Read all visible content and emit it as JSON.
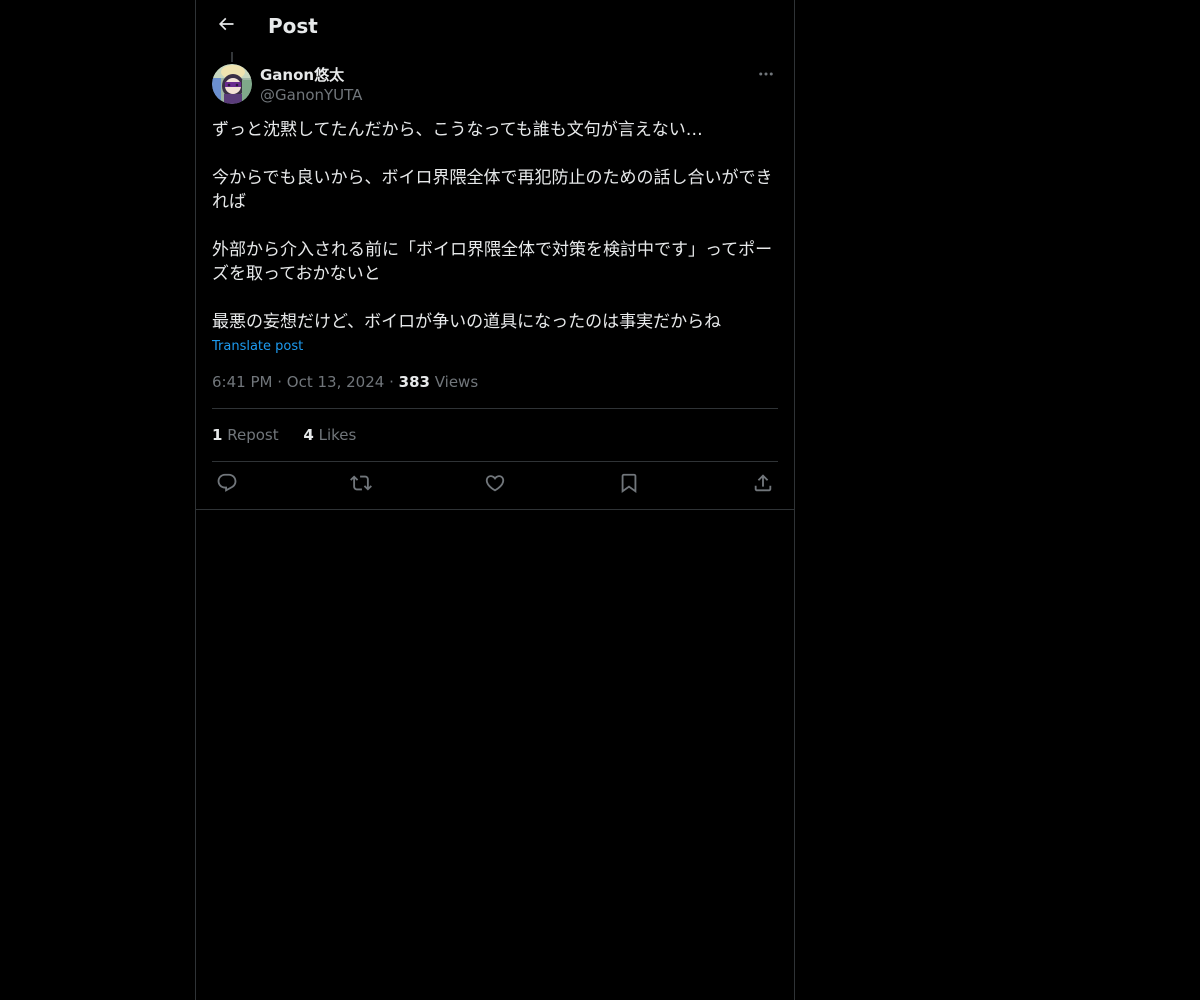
{
  "header": {
    "title": "Post",
    "back_icon": "arrow-left-icon"
  },
  "post": {
    "author": {
      "name": "Ganon悠太",
      "handle": "@GanonYUTA"
    },
    "paragraphs": [
      "ずっと沈黙してたんだから、こうなっても誰も文句が言えない…",
      "今からでも良いから、ボイロ界隈全体で再犯防止のための話し合いができれば",
      "外部から介入される前に「ボイロ界隈全体で対策を検討中です」ってポーズを取っておかないと",
      "最悪の妄想だけど、ボイロが争いの道具になったのは事実だからね"
    ],
    "translate_label": "Translate post",
    "time": "6:41 PM",
    "date": "Oct 13, 2024",
    "separator": "·",
    "views_count": "383",
    "views_label": "Views",
    "reposts_count": "1",
    "reposts_label": "Repost",
    "likes_count": "4",
    "likes_label": "Likes"
  },
  "actions": {
    "icons": [
      "reply-icon",
      "repost-icon",
      "like-icon",
      "bookmark-icon",
      "share-icon"
    ]
  },
  "colors": {
    "background": "#000000",
    "text": "#e7e9ea",
    "secondary": "#71767b",
    "link": "#1d9bf0",
    "border": "#2f3336"
  }
}
